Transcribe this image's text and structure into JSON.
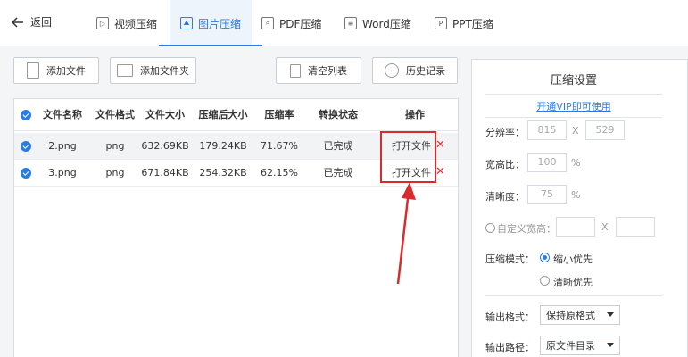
{
  "nav": {
    "back_label": "返回",
    "tabs": [
      {
        "label": "视频压缩",
        "icon": "video-icon"
      },
      {
        "label": "图片压缩",
        "icon": "image-icon",
        "active": true
      },
      {
        "label": "PDF压缩",
        "icon": "pdf-icon"
      },
      {
        "label": "Word压缩",
        "icon": "word-icon"
      },
      {
        "label": "PPT压缩",
        "icon": "ppt-icon"
      }
    ]
  },
  "toolbar": {
    "add_file": "添加文件",
    "add_folder": "添加文件夹",
    "clear_list": "清空列表",
    "history": "历史记录"
  },
  "table": {
    "headers": [
      "文件名称",
      "文件格式",
      "文件大小",
      "压缩后大小",
      "压缩率",
      "转换状态",
      "操作"
    ],
    "rows": [
      {
        "name": "2.png",
        "format": "png",
        "size": "632.69KB",
        "compressed": "179.24KB",
        "ratio": "71.67%",
        "status": "已完成",
        "action": "打开文件"
      },
      {
        "name": "3.png",
        "format": "png",
        "size": "671.84KB",
        "compressed": "254.32KB",
        "ratio": "62.15%",
        "status": "已完成",
        "action": "打开文件"
      }
    ]
  },
  "settings": {
    "title": "压缩设置",
    "vip_link": "开通VIP即可使用",
    "resolution_label": "分辨率：",
    "res_w": "815",
    "res_sep": "X",
    "res_h": "529",
    "aspect_label": "宽高比：",
    "aspect_value": "100",
    "clarity_label": "清晰度：",
    "clarity_value": "75",
    "percent": "%",
    "custom_label": "自定义宽高：",
    "custom_sep": "X",
    "mode_label": "压缩模式：",
    "mode_small": "缩小优先",
    "mode_clear": "清晰优先",
    "format_label": "输出格式：",
    "format_value": "保持原格式",
    "path_label": "输出路径：",
    "path_value": "原文件目录"
  },
  "colors": {
    "accent": "#2a7be4",
    "highlight_box": "#d92b2b",
    "delete": "#d9353a"
  }
}
